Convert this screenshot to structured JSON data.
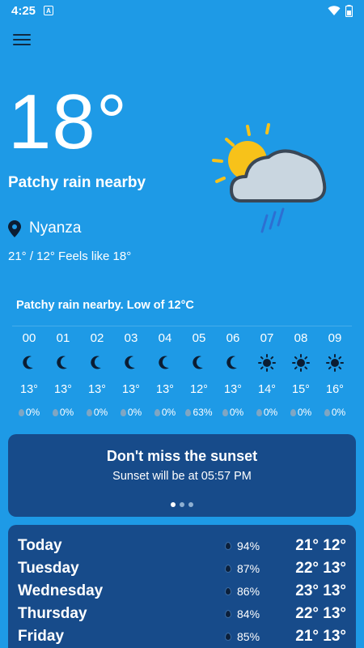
{
  "status": {
    "time": "4:25",
    "notif_letter": "A"
  },
  "current": {
    "temp": "18°",
    "condition": "Patchy rain nearby",
    "location": "Nyanza",
    "hilo": "21° / 12°  Feels like 18°"
  },
  "hourly": {
    "title": "Patchy rain nearby. Low of 12°C",
    "hours": [
      {
        "h": "00",
        "icon": "moon-icon",
        "t": "13°",
        "p": "0%"
      },
      {
        "h": "01",
        "icon": "moon-icon",
        "t": "13°",
        "p": "0%"
      },
      {
        "h": "02",
        "icon": "moon-icon",
        "t": "13°",
        "p": "0%"
      },
      {
        "h": "03",
        "icon": "moon-icon",
        "t": "13°",
        "p": "0%"
      },
      {
        "h": "04",
        "icon": "moon-icon",
        "t": "13°",
        "p": "0%"
      },
      {
        "h": "05",
        "icon": "moon-icon",
        "t": "12°",
        "p": "63%"
      },
      {
        "h": "06",
        "icon": "moon-icon",
        "t": "13°",
        "p": "0%"
      },
      {
        "h": "07",
        "icon": "sun-icon",
        "t": "14°",
        "p": "0%"
      },
      {
        "h": "08",
        "icon": "sun-icon",
        "t": "15°",
        "p": "0%"
      },
      {
        "h": "09",
        "icon": "sun-icon",
        "t": "16°",
        "p": "0%"
      }
    ]
  },
  "sunset": {
    "title": "Don't miss the sunset",
    "sub": "Sunset will be at 05:57 PM"
  },
  "daily": [
    {
      "name": "Today",
      "rain": "94%",
      "temps": "21° 12°"
    },
    {
      "name": "Tuesday",
      "rain": "87%",
      "temps": "22° 13°"
    },
    {
      "name": "Wednesday",
      "rain": "86%",
      "temps": "23° 13°"
    },
    {
      "name": "Thursday",
      "rain": "84%",
      "temps": "22° 13°"
    },
    {
      "name": "Friday",
      "rain": "85%",
      "temps": "21° 13°"
    }
  ],
  "colors": {
    "background": "#1e9ae6",
    "card": "#174b8a"
  }
}
